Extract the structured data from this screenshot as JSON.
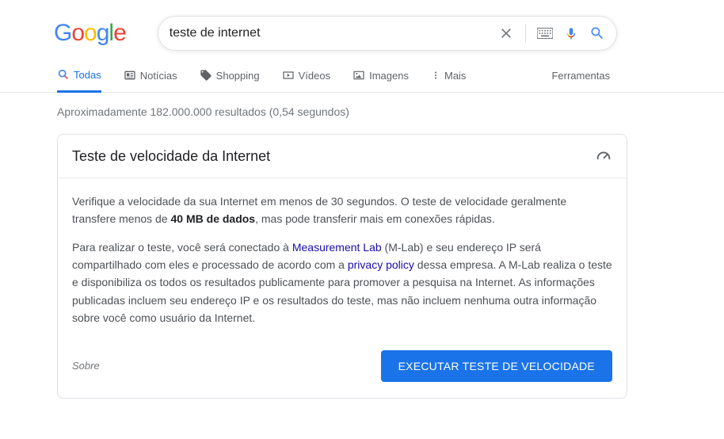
{
  "search": {
    "value": "teste de internet"
  },
  "tabs": {
    "all": "Todas",
    "news": "Notícias",
    "shopping": "Shopping",
    "videos": "Vídeos",
    "images": "Imagens",
    "more": "Mais",
    "tools": "Ferramentas"
  },
  "result_stats": "Aproximadamente 182.000.000 resultados (0,54 segundos)",
  "card": {
    "title": "Teste de velocidade da Internet",
    "p1_pre": "Verifique a velocidade da sua Internet em menos de 30 segundos. O teste de velocidade geralmente transfere menos de ",
    "p1_bold": "40 MB de dados",
    "p1_post": ", mas pode transferir mais em conexões rápidas.",
    "p2_pre": "Para realizar o teste, você será conectado à ",
    "p2_link1": "Measurement Lab",
    "p2_mid1": " (M-Lab) e seu endereço IP será compartilhado com eles e processado de acordo com a ",
    "p2_link2": "privacy policy",
    "p2_post": " dessa empresa. A M-Lab realiza o teste e disponibiliza os todos os resultados publicamente para promover a pesquisa na Internet. As informações publicadas incluem seu endereço IP e os resultados do teste, mas não incluem nenhuma outra informação sobre você como usuário da Internet.",
    "about": "Sobre",
    "run": "EXECUTAR TESTE DE VELOCIDADE"
  }
}
